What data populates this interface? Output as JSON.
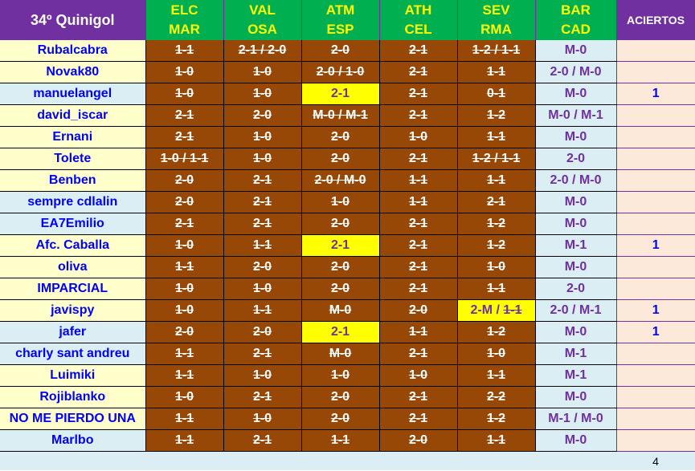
{
  "header": {
    "title": "34º Quinigol",
    "matches": [
      {
        "home": "ELC",
        "away": "MAR"
      },
      {
        "home": "VAL",
        "away": "OSA"
      },
      {
        "home": "ATM",
        "away": "ESP"
      },
      {
        "home": "ATH",
        "away": "CEL"
      },
      {
        "home": "SEV",
        "away": "RMA"
      },
      {
        "home": "BAR",
        "away": "CAD"
      }
    ],
    "aciertos": "ACIERTOS"
  },
  "colors": {
    "header_green": "#00b050",
    "header_purple": "#7030a0",
    "pick_brown": "#974706",
    "hit_yellow": "#ffff00",
    "name_blue": "#0000ff"
  },
  "rows": [
    {
      "name": "Rubalcabra",
      "bg": "yellow",
      "picks": [
        "1-1",
        "2-1 / 2-0",
        "2-0",
        "2-1",
        "1-2 / 1-1"
      ],
      "bar": "M-0",
      "aciertos": ""
    },
    {
      "name": "Novak80",
      "bg": "yellow",
      "picks": [
        "1-0",
        "1-0",
        "2-0 / 1-0",
        "2-1",
        "1-1"
      ],
      "bar": "2-0 / M-0",
      "aciertos": ""
    },
    {
      "name": "manuelangel",
      "bg": "blue",
      "picks": [
        "1-0",
        "1-0",
        {
          "text": "2-1",
          "hit": true
        },
        "2-1",
        "0-1"
      ],
      "bar": "M-0",
      "aciertos": "1"
    },
    {
      "name": "david_iscar",
      "bg": "yellow",
      "picks": [
        "2-1",
        "2-0",
        "M-0 / M-1",
        "2-1",
        "1-2"
      ],
      "bar": "M-0 / M-1",
      "aciertos": ""
    },
    {
      "name": "Ernani",
      "bg": "yellow",
      "picks": [
        "2-1",
        "1-0",
        "2-0",
        "1-0",
        "1-1"
      ],
      "bar": "M-0",
      "aciertos": ""
    },
    {
      "name": "Tolete",
      "bg": "yellow",
      "picks": [
        "1-0 / 1-1",
        "1-0",
        "2-0",
        "2-1",
        "1-2 / 1-1"
      ],
      "bar": "2-0",
      "aciertos": ""
    },
    {
      "name": "Benben",
      "bg": "yellow",
      "picks": [
        "2-0",
        "2-1",
        "2-0 / M-0",
        "1-1",
        "1-1"
      ],
      "bar": "2-0 / M-0",
      "aciertos": ""
    },
    {
      "name": "sempre cdlalin",
      "bg": "blue",
      "picks": [
        "2-0",
        "2-1",
        "1-0",
        "1-1",
        "2-1"
      ],
      "bar": "M-0",
      "aciertos": ""
    },
    {
      "name": "EA7Emilio",
      "bg": "blue",
      "picks": [
        "2-1",
        "2-1",
        "2-0",
        "2-1",
        "1-2"
      ],
      "bar": "M-0",
      "aciertos": ""
    },
    {
      "name": "Afc. Caballa",
      "bg": "yellow",
      "picks": [
        "1-0",
        "1-1",
        {
          "text": "2-1",
          "hit": true
        },
        "2-1",
        "1-2"
      ],
      "bar": "M-1",
      "aciertos": "1"
    },
    {
      "name": "oliva",
      "bg": "yellow",
      "picks": [
        "1-1",
        "2-0",
        "2-0",
        "2-1",
        "1-0"
      ],
      "bar": "M-0",
      "aciertos": ""
    },
    {
      "name": "IMPARCIAL",
      "bg": "yellow",
      "picks": [
        "1-0",
        "1-0",
        "2-0",
        "2-1",
        "1-1"
      ],
      "bar": "2-0",
      "aciertos": ""
    },
    {
      "name": "javispy",
      "bg": "yellow",
      "picks": [
        "1-0",
        "1-1",
        "M-0",
        "2-0",
        {
          "text": "2-M / ",
          "struck": "1-1",
          "hit": true
        }
      ],
      "bar": "2-0 / M-1",
      "aciertos": "1"
    },
    {
      "name": "jafer",
      "bg": "blue",
      "picks": [
        "2-0",
        "2-0",
        {
          "text": "2-1",
          "hit": true
        },
        "1-1",
        "1-2"
      ],
      "bar": "M-0",
      "aciertos": "1"
    },
    {
      "name": "charly sant andreu",
      "bg": "blue",
      "picks": [
        "1-1",
        "2-1",
        "M-0",
        "2-1",
        "1-0"
      ],
      "bar": "M-1",
      "aciertos": ""
    },
    {
      "name": "Luimiki",
      "bg": "yellow",
      "picks": [
        "1-1",
        "1-0",
        "1-0",
        "1-0",
        "1-1"
      ],
      "bar": "M-1",
      "aciertos": ""
    },
    {
      "name": "Rojiblanko",
      "bg": "yellow",
      "picks": [
        "1-0",
        "2-1",
        "2-0",
        "2-1",
        "2-2"
      ],
      "bar": "M-0",
      "aciertos": ""
    },
    {
      "name": "NO ME PIERDO UNA",
      "bg": "yellow",
      "picks": [
        "1-1",
        "1-0",
        "2-0",
        "2-1",
        "1-2"
      ],
      "bar": "M-1 / M-0",
      "aciertos": ""
    },
    {
      "name": "Marlbo",
      "bg": "blue",
      "picks": [
        "1-1",
        "2-1",
        "1-1",
        "2-0",
        "1-1"
      ],
      "bar": "M-0",
      "aciertos": ""
    }
  ],
  "footer": {
    "total": "4"
  }
}
